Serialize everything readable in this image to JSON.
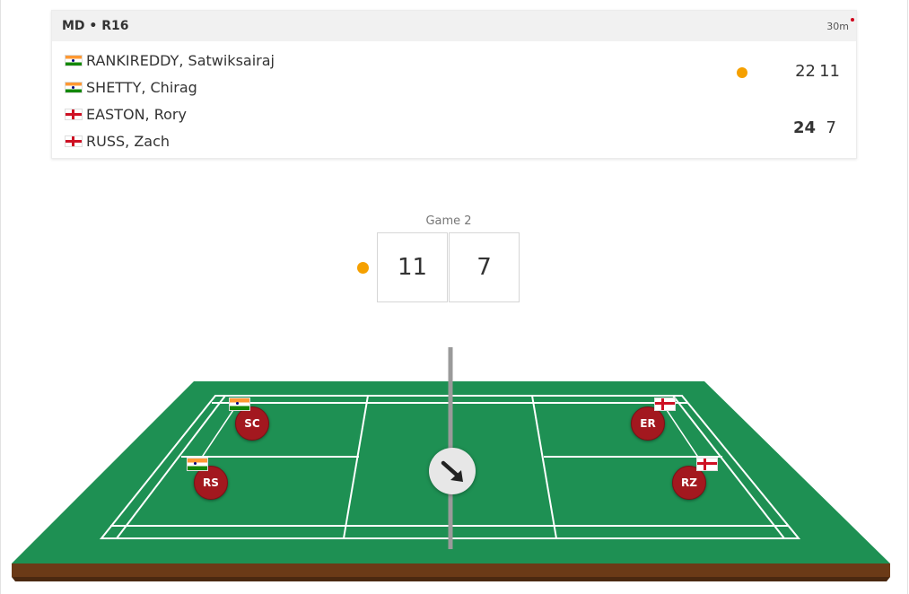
{
  "match": {
    "event": "MD • R16",
    "duration": "30m",
    "team1": {
      "players": [
        {
          "name": "RANKIREDDY, Satwiksairaj",
          "flag": "india-flag-icon"
        },
        {
          "name": "SHETTY, Chirag",
          "flag": "india-flag-icon"
        }
      ],
      "game1": "22",
      "game2": "11",
      "serving": true
    },
    "team2": {
      "players": [
        {
          "name": "EASTON, Rory",
          "flag": "england-flag-icon"
        },
        {
          "name": "RUSS, Zach",
          "flag": "england-flag-icon"
        }
      ],
      "game1": "24",
      "game2": "7",
      "serving": false
    }
  },
  "current_game": {
    "label": "Game 2",
    "score_left": "11",
    "score_right": "7"
  },
  "court": {
    "players": [
      {
        "initials": "SC",
        "team": "india"
      },
      {
        "initials": "RS",
        "team": "india"
      },
      {
        "initials": "ER",
        "team": "england"
      },
      {
        "initials": "RZ",
        "team": "england"
      }
    ],
    "shuttle_icon": "arrow-down-right-icon"
  },
  "colors": {
    "court_green": "#1e9053",
    "court_base": "#6b3a17",
    "token_red": "#a3181f",
    "serve_orange": "#f5a000",
    "live_red": "#d0021b"
  }
}
